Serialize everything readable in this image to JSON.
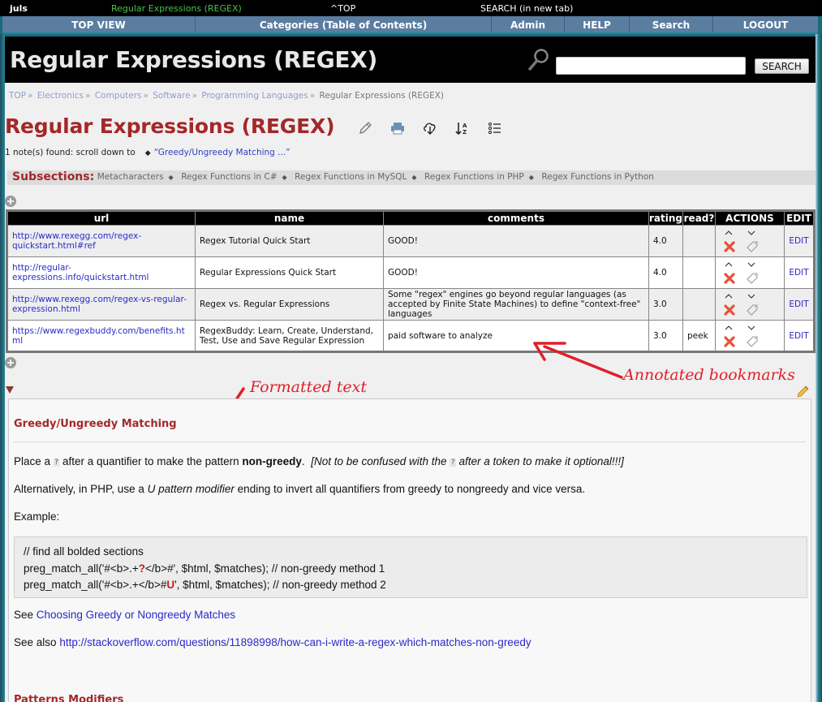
{
  "topbar": {
    "user": "juls",
    "page_title": "Regular Expressions (REGEX)",
    "top_link": "^TOP",
    "search_link": "SEARCH (in new tab)"
  },
  "nav": {
    "items": [
      {
        "label": "TOP VIEW"
      },
      {
        "label": "Categories (Table of Contents)"
      },
      {
        "label": "Admin"
      },
      {
        "label": "HELP"
      },
      {
        "label": "Search"
      },
      {
        "label": "LOGOUT"
      }
    ]
  },
  "banner": {
    "title": "Regular Expressions (REGEX)",
    "search_value": "",
    "search_button": "SEARCH"
  },
  "breadcrumb": {
    "items": [
      "TOP",
      "Electronics",
      "Computers",
      "Software",
      "Programming Languages"
    ],
    "current": "Regular Expressions (REGEX)",
    "separator": "»"
  },
  "page": {
    "title": "Regular Expressions (REGEX)",
    "tools": [
      "pencil-icon",
      "print-icon",
      "cloud-download-icon",
      "sort-az-icon",
      "list-icon"
    ],
    "notes_found": "1 note(s) found: scroll down to",
    "note_link": "“Greedy/Ungreedy Matching ...”"
  },
  "subsections": {
    "label": "Subsections:",
    "items": [
      "Metacharacters",
      "Regex Functions in C#",
      "Regex Functions in MySQL",
      "Regex Functions in PHP",
      "Regex Functions in Python"
    ]
  },
  "bookmarks": {
    "columns": [
      "url",
      "name",
      "comments",
      "rating",
      "read?",
      "ACTIONS",
      "EDIT"
    ],
    "rows": [
      {
        "url": "http://www.rexegg.com/regex-quickstart.html#ref",
        "name": "Regex Tutorial Quick Start",
        "comments": "GOOD!",
        "rating": "4.0",
        "read": "",
        "edit": "EDIT"
      },
      {
        "url": "http://regular-expressions.info/quickstart.html",
        "name": "Regular Expressions Quick Start",
        "comments": "GOOD!",
        "rating": "4.0",
        "read": "",
        "edit": "EDIT"
      },
      {
        "url": "http://www.rexegg.com/regex-vs-regular-expression.html",
        "name": "Regex vs. Regular Expressions",
        "comments": "Some \"regex\" engines go beyond regular languages (as accepted by Finite State Machines) to define \"context-free\" languages",
        "rating": "3.0",
        "read": "",
        "edit": "EDIT"
      },
      {
        "url": "https://www.regexbuddy.com/benefits.html",
        "name": "RegexBuddy: Learn, Create, Understand, Test, Use and Save Regular Expression",
        "comments": "paid software to analyze",
        "rating": "3.0",
        "read": "peek",
        "edit": "EDIT"
      }
    ]
  },
  "annotations": {
    "bookmarks": "Annotated bookmarks",
    "formatted": "Formatted text"
  },
  "note": {
    "heading": "Greedy/Ungreedy Matching",
    "p1_a": "Place a",
    "p1_q": "?",
    "p1_b": "after a quantifier to make the pattern",
    "p1_bold": "non-greedy",
    "p1_c": ".",
    "p1_it_a": "[Not to be confused with the",
    "p1_it_q": "?",
    "p1_it_b": "after a token to make it optional!!!]",
    "p2_a": "Alternatively, in PHP, use a",
    "p2_it": "U pattern modifier",
    "p2_b": "ending to invert all quantifiers from greedy to nongreedy and vice versa.",
    "p3": "Example:",
    "code": {
      "line1": "// find all bolded sections",
      "line2_a": "preg_match_all('#<b>.+",
      "line2_red": "?",
      "line2_b": "</b>#', $html, $matches);  // non-greedy method 1",
      "line3_a": "preg_match_all('#<b>.+</b>#",
      "line3_red": "U",
      "line3_b": "', $html, $matches);  // non-greedy method 2"
    },
    "see_label": "See",
    "see_link": "Choosing Greedy or Nongreedy Matches",
    "see_also_label": "See also",
    "see_also_link": "http://stackoverflow.com/questions/11898998/how-can-i-write-a-regex-which-matches-non-greedy",
    "heading2": "Patterns Modifiers"
  }
}
